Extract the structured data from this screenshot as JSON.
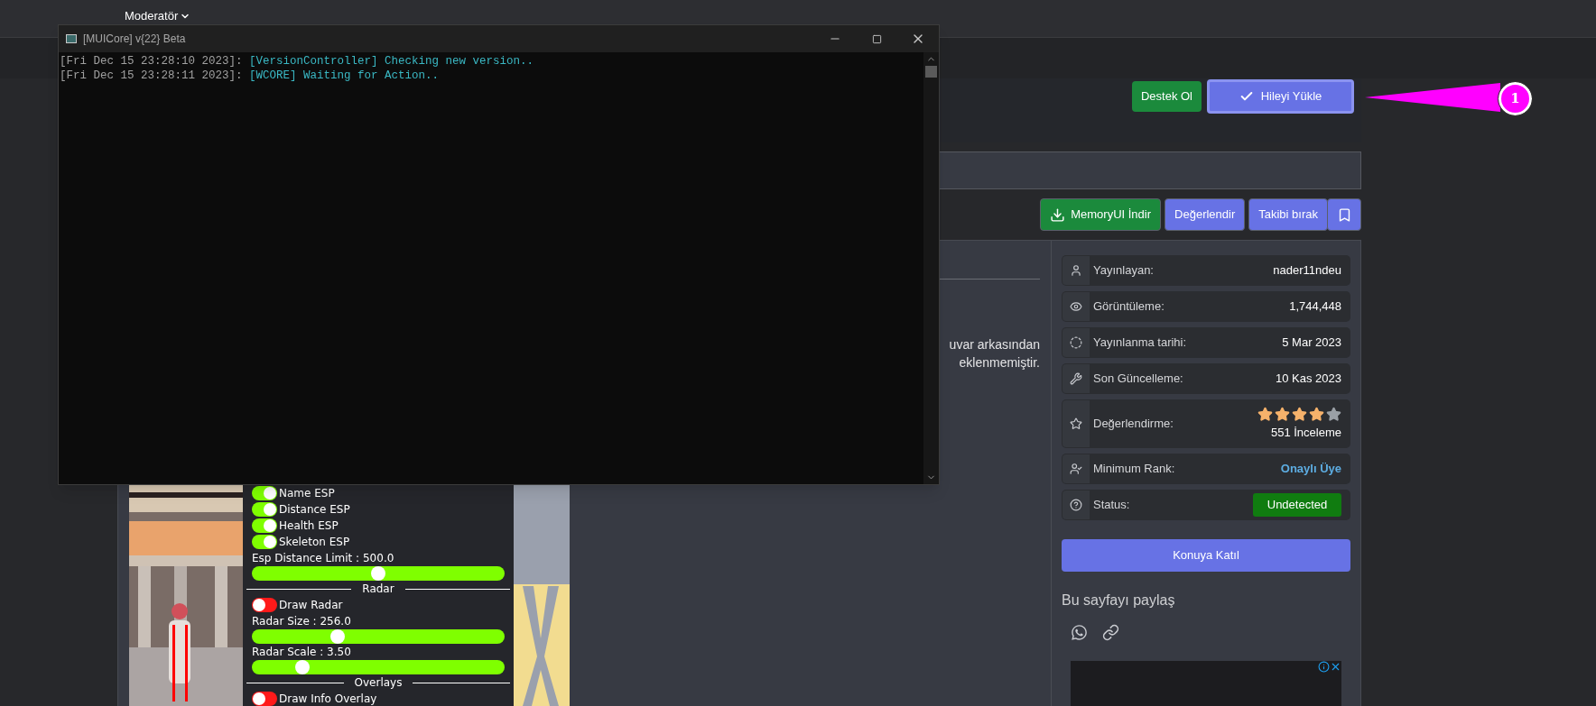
{
  "top_nav": {
    "menu": "Moderatör"
  },
  "console": {
    "title": "[MUICore] v{22} Beta",
    "lines": [
      {
        "timestamp": "[Fri Dec 15 23:28:10 2023]:",
        "message": "[VersionController] Checking new version.."
      },
      {
        "timestamp": "[Fri Dec 15 23:28:11 2023]:",
        "message": "[WCORE] Waiting for Action.."
      }
    ]
  },
  "header_buttons": [
    {
      "label": "Destek Ol",
      "kind": "success"
    },
    {
      "label": "Hileyi Yükle",
      "kind": "primary"
    }
  ],
  "annotation": {
    "label": "1"
  },
  "actions": [
    {
      "label": "MemoryUI İndir",
      "kind": "success"
    },
    {
      "label": "Değerlendir",
      "kind": "primary"
    },
    {
      "label": "Takibi bırak",
      "kind": "primary"
    }
  ],
  "description": {
    "lines": [
      "uvar arkasından",
      "eklenmemiştir."
    ]
  },
  "game_menu": {
    "items": [
      {
        "kind": "toggle",
        "label": "Name ESP",
        "on": true
      },
      {
        "kind": "toggle",
        "label": "Distance ESP",
        "on": true
      },
      {
        "kind": "toggle",
        "label": "Health ESP",
        "on": true
      },
      {
        "kind": "toggle",
        "label": "Skeleton ESP",
        "on": true
      },
      {
        "kind": "slider",
        "label": "Esp Distance Limit : 500.0",
        "level": 0.5
      },
      {
        "kind": "header",
        "label": "Radar"
      },
      {
        "kind": "toggle",
        "label": "Draw Radar",
        "on": false
      },
      {
        "kind": "slider",
        "label": "Radar Size : 256.0",
        "level": 0.34
      },
      {
        "kind": "slider",
        "label": "Radar Scale : 3.50",
        "level": 0.2
      },
      {
        "kind": "header",
        "label": "Overlays"
      },
      {
        "kind": "toggle",
        "label": "Draw Info Overlay",
        "on": false
      }
    ]
  },
  "info": [
    {
      "kind": "text",
      "label": "Yayınlayan:",
      "value": "nader11ndeu"
    },
    {
      "kind": "text",
      "label": "Görüntüleme:",
      "value": "1,744,448"
    },
    {
      "kind": "text",
      "label": "Yayınlanma tarihi:",
      "value": "5 Mar 2023"
    },
    {
      "kind": "text",
      "label": "Son Güncelleme:",
      "value": "10 Kas 2023"
    },
    {
      "kind": "rating",
      "label": "Değerlendirme:",
      "stars": 4,
      "value": "551 İnceleme"
    },
    {
      "kind": "link",
      "label": "Minimum Rank:",
      "value": "Onaylı Üye"
    },
    {
      "kind": "badge",
      "label": "Status:",
      "value": "Undetected"
    }
  ],
  "join_button": "Konuya Katıl",
  "share": {
    "title": "Bu sayfayı paylaş"
  }
}
